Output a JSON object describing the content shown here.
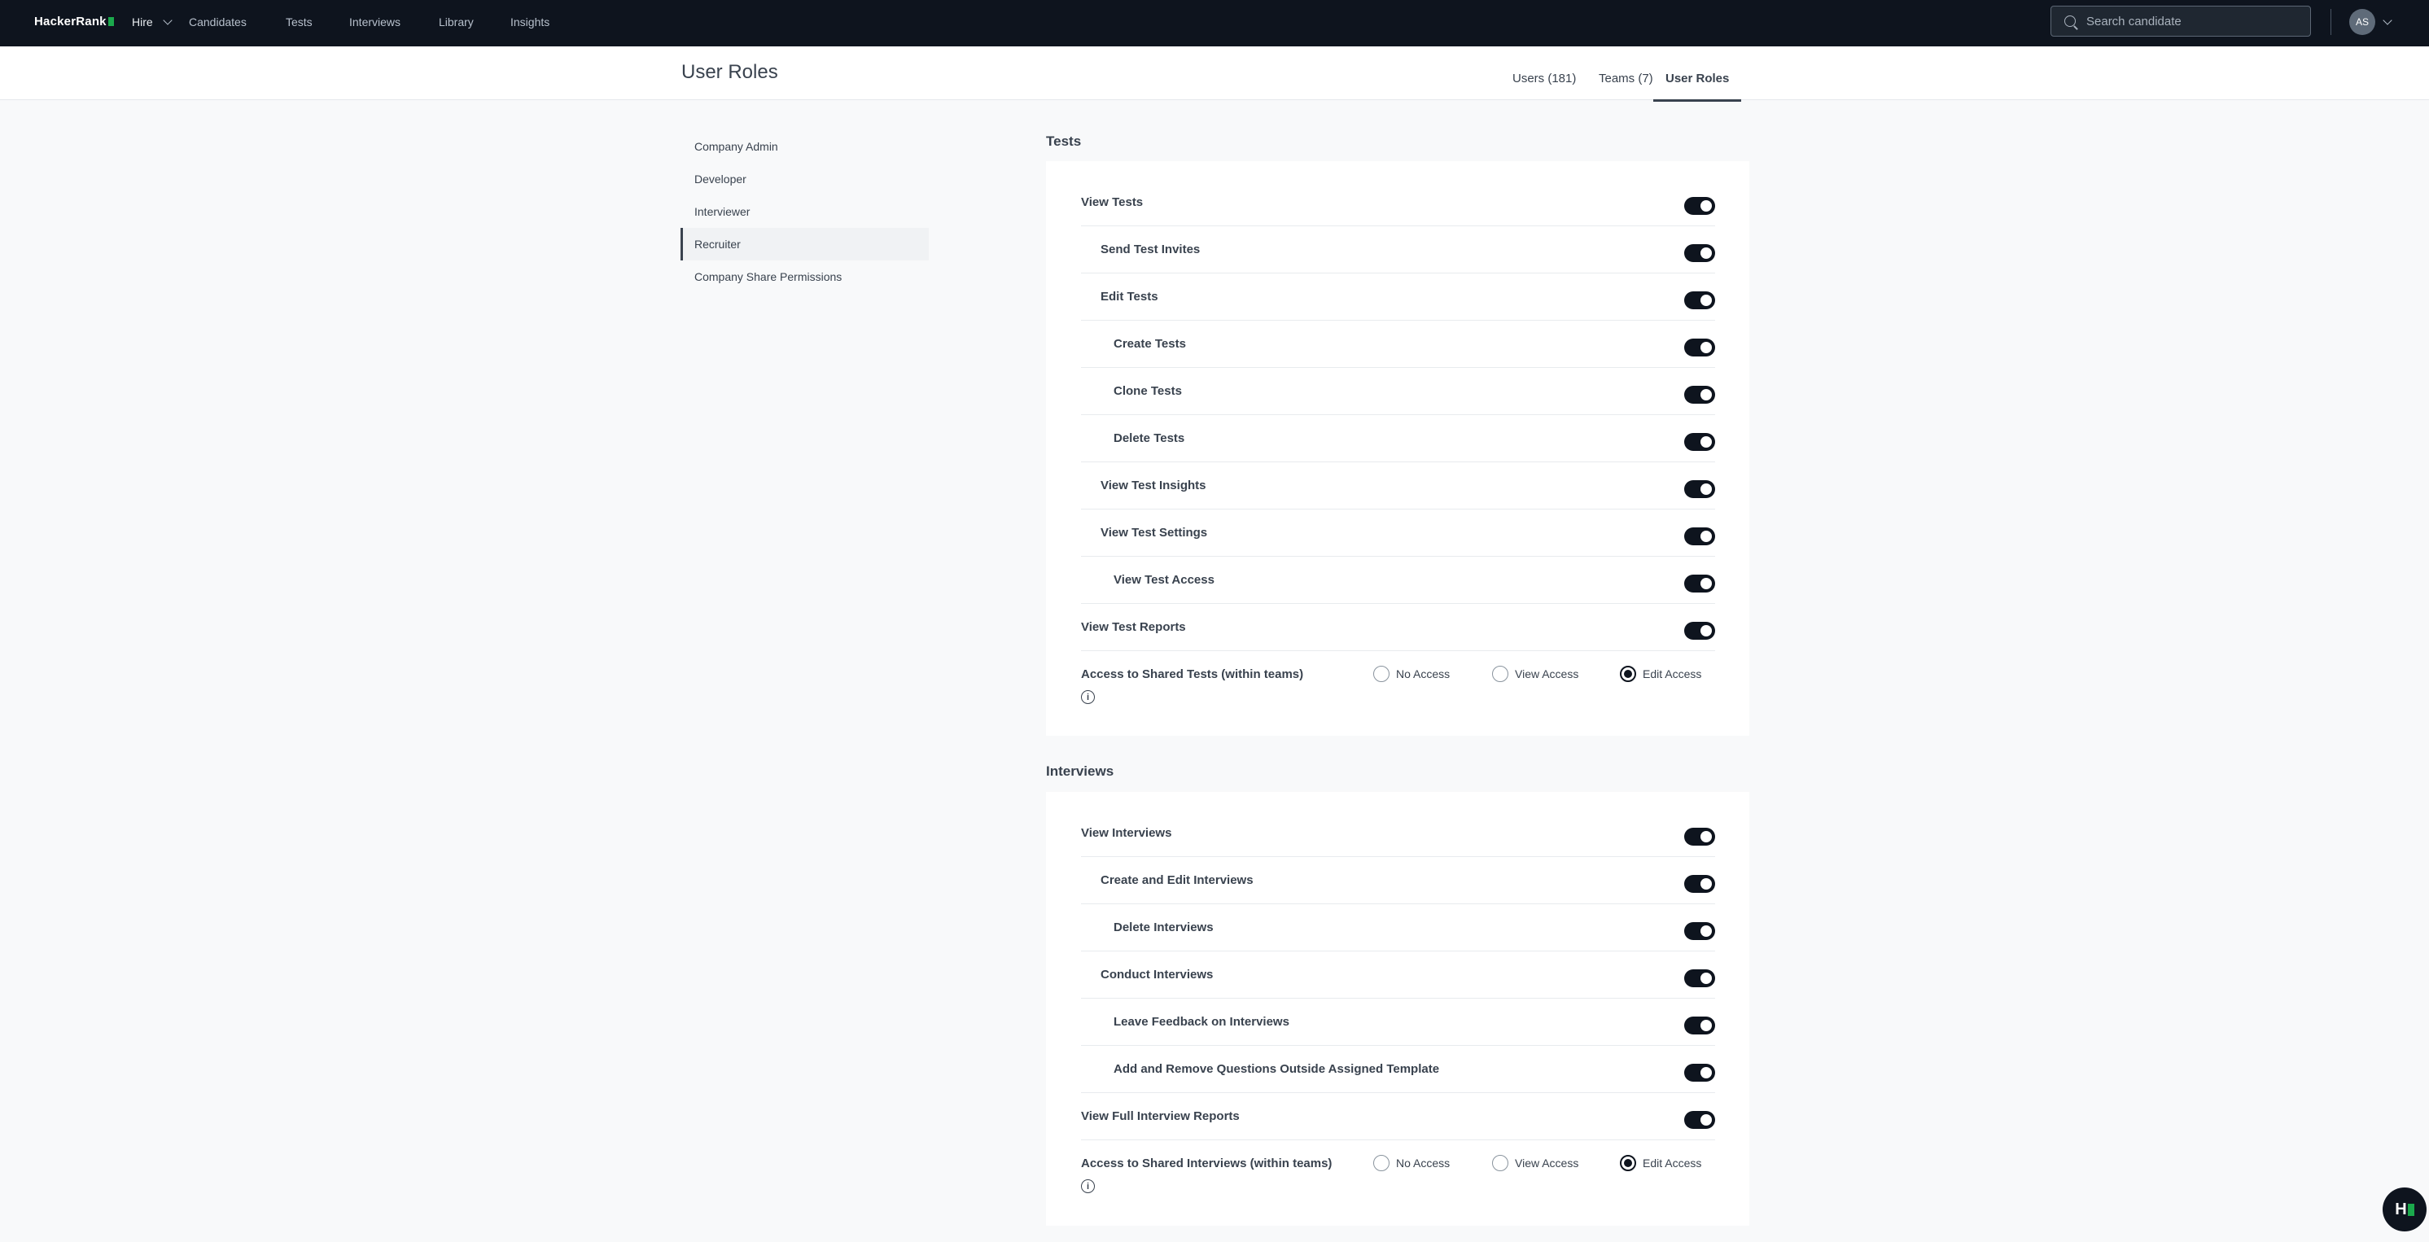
{
  "topnav": {
    "brand": "HackerRank",
    "hire_label": "Hire",
    "links": [
      "Candidates",
      "Tests",
      "Interviews",
      "Library",
      "Insights"
    ],
    "search_placeholder": "Search candidate",
    "avatar_initials": "AS"
  },
  "header": {
    "title": "User Roles",
    "tabs": [
      "Users (181)",
      "Teams (7)",
      "User Roles"
    ],
    "active_tab": "User Roles"
  },
  "sidebar": {
    "items": [
      "Company Admin",
      "Developer",
      "Interviewer",
      "Recruiter",
      "Company Share Permissions"
    ],
    "active": "Recruiter"
  },
  "tests": {
    "title": "Tests",
    "permissions": [
      {
        "label": "View Tests",
        "level": 0,
        "enabled": true
      },
      {
        "label": "Send Test Invites",
        "level": 1,
        "enabled": true
      },
      {
        "label": "Edit Tests",
        "level": 1,
        "enabled": true
      },
      {
        "label": "Create Tests",
        "level": 2,
        "enabled": true
      },
      {
        "label": "Clone Tests",
        "level": 2,
        "enabled": true
      },
      {
        "label": "Delete Tests",
        "level": 2,
        "enabled": true
      },
      {
        "label": "View Test Insights",
        "level": 1,
        "enabled": true
      },
      {
        "label": "View Test Settings",
        "level": 1,
        "enabled": true
      },
      {
        "label": "View Test Access",
        "level": 2,
        "enabled": true
      },
      {
        "label": "View Test Reports",
        "level": 0,
        "enabled": true
      }
    ],
    "shared": {
      "label": "Access to Shared Tests (within teams)",
      "options": [
        "No Access",
        "View Access",
        "Edit Access"
      ],
      "selected": "Edit Access"
    }
  },
  "interviews": {
    "title": "Interviews",
    "permissions": [
      {
        "label": "View Interviews",
        "level": 0,
        "enabled": true
      },
      {
        "label": "Create and Edit Interviews",
        "level": 1,
        "enabled": true
      },
      {
        "label": "Delete Interviews",
        "level": 2,
        "enabled": true
      },
      {
        "label": "Conduct Interviews",
        "level": 1,
        "enabled": true
      },
      {
        "label": "Leave Feedback on Interviews",
        "level": 2,
        "enabled": true
      },
      {
        "label": "Add and Remove Questions Outside Assigned Template",
        "level": 2,
        "enabled": true
      },
      {
        "label": "View Full Interview Reports",
        "level": 0,
        "enabled": true
      }
    ],
    "shared": {
      "label": "Access to Shared Interviews (within teams)",
      "options": [
        "No Access",
        "View Access",
        "Edit Access"
      ],
      "selected": "Edit Access"
    }
  },
  "colors": {
    "nav_bg": "#0e141e",
    "accent_green": "#1ba94c",
    "text": "#39424e"
  }
}
